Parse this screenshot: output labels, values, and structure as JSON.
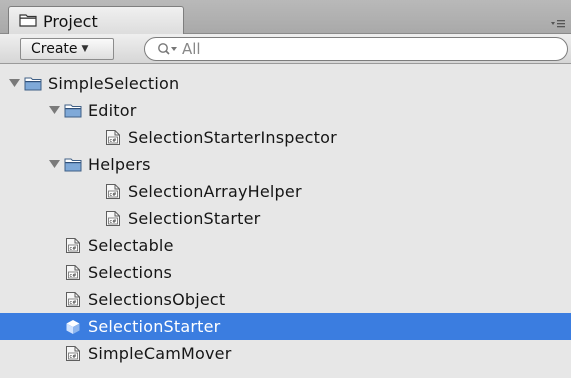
{
  "panel": {
    "tab_label": "Project"
  },
  "toolbar": {
    "create_label": "Create",
    "search_placeholder": "All"
  },
  "tree": [
    {
      "label": "SimpleSelection",
      "type": "folder",
      "expanded": true,
      "depth": 0
    },
    {
      "label": "Editor",
      "type": "folder",
      "expanded": true,
      "depth": 1
    },
    {
      "label": "SelectionStarterInspector",
      "type": "script",
      "depth": 2
    },
    {
      "label": "Helpers",
      "type": "folder",
      "expanded": true,
      "depth": 1
    },
    {
      "label": "SelectionArrayHelper",
      "type": "script",
      "depth": 2
    },
    {
      "label": "SelectionStarter",
      "type": "script",
      "depth": 2
    },
    {
      "label": "Selectable",
      "type": "script",
      "depth": 1
    },
    {
      "label": "Selections",
      "type": "script",
      "depth": 1
    },
    {
      "label": "SelectionsObject",
      "type": "script",
      "depth": 1
    },
    {
      "label": "SelectionStarter",
      "type": "prefab",
      "depth": 1,
      "selected": true
    },
    {
      "label": "SimpleCamMover",
      "type": "script",
      "depth": 1
    }
  ],
  "colors": {
    "selection": "#3b7de0",
    "background": "#e7e7e7",
    "folder": "#7fa9d8"
  }
}
